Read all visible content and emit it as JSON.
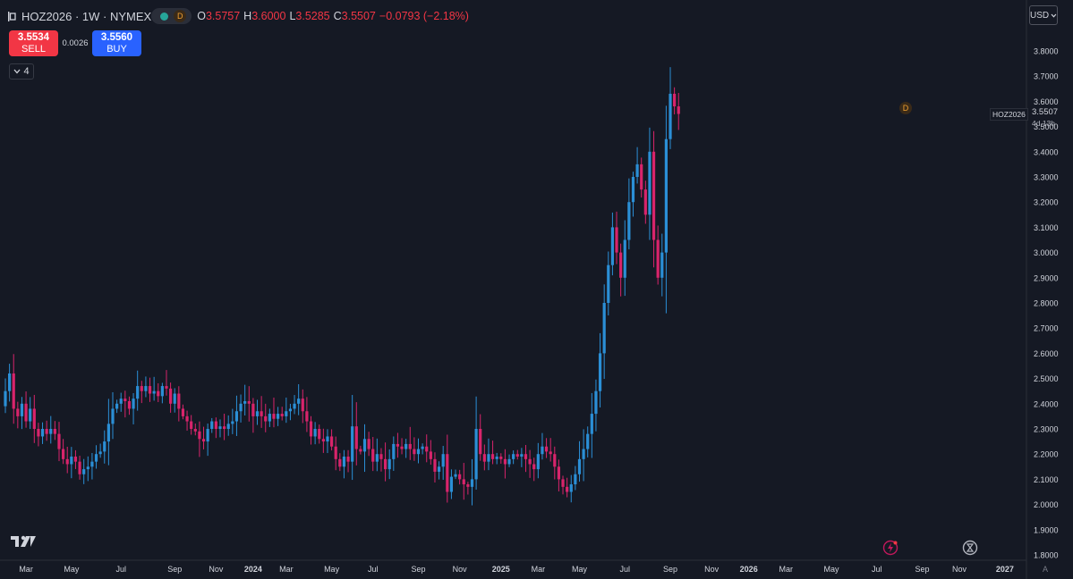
{
  "header": {
    "symbol": "HOZ2026 · 1W · NYMEX",
    "badge": "D",
    "ohlc": [
      {
        "k": "O",
        "v": "3.5757"
      },
      {
        "k": "H",
        "v": "3.6000"
      },
      {
        "k": "L",
        "v": "3.5285"
      },
      {
        "k": "C",
        "v": "3.5507"
      }
    ],
    "change": "−0.0793 (−2.18%)"
  },
  "trade": {
    "sell_price": "3.5534",
    "sell_label": "SELL",
    "spread": "0.0026",
    "buy_price": "3.5560",
    "buy_label": "BUY"
  },
  "indicators": {
    "count": "4"
  },
  "currency": "USD",
  "symbol_tag": "HOZ2026",
  "last_price": "3.5507",
  "countdown": "4d 13h",
  "marker_label": "D",
  "auto_label": "A",
  "colors": {
    "up": "#2b8fd6",
    "down": "#d8246b",
    "bg": "#151924",
    "grid": "#1e222d"
  },
  "chart_data": {
    "type": "candlestick",
    "title": "",
    "xlabel": "",
    "ylabel": "",
    "ylim": [
      1.8,
      3.8
    ],
    "y_ticks": [
      "3.8000",
      "3.7000",
      "3.6000",
      "3.5000",
      "3.4000",
      "3.3000",
      "3.2000",
      "3.1000",
      "3.0000",
      "2.9000",
      "2.8000",
      "2.7000",
      "2.6000",
      "2.5000",
      "2.4000",
      "2.3000",
      "2.2000",
      "2.1000",
      "2.0000",
      "1.9000",
      "1.8000"
    ],
    "x_ticks": [
      "Mar",
      "May",
      "Jul",
      "Sep",
      "Nov",
      "2024",
      "Mar",
      "May",
      "Jul",
      "Sep",
      "Nov",
      "2025",
      "Mar",
      "May",
      "Jul",
      "Sep",
      "Nov",
      "2026",
      "Mar",
      "May",
      "Jul",
      "Sep",
      "Nov",
      "2027"
    ],
    "x_tick_weeks": [
      5,
      16,
      28,
      41,
      51,
      60,
      68,
      79,
      89,
      100,
      110,
      120,
      129,
      139,
      150,
      161,
      171,
      180,
      189,
      200,
      211,
      222,
      231,
      242
    ],
    "series": [
      {
        "weekly_close": [
          2.45,
          2.52,
          2.38,
          2.35,
          2.4,
          2.33,
          2.38,
          2.3,
          2.27,
          2.3,
          2.28,
          2.3,
          2.28,
          2.22,
          2.18,
          2.16,
          2.19,
          2.17,
          2.12,
          2.14,
          2.15,
          2.17,
          2.2,
          2.21,
          2.25,
          2.32,
          2.38,
          2.4,
          2.42,
          2.41,
          2.38,
          2.42,
          2.47,
          2.45,
          2.47,
          2.44,
          2.45,
          2.43,
          2.47,
          2.46,
          2.4,
          2.44,
          2.38,
          2.35,
          2.33,
          2.3,
          2.29,
          2.26,
          2.25,
          2.3,
          2.33,
          2.3,
          2.31,
          2.3,
          2.32,
          2.33,
          2.37,
          2.4,
          2.41,
          2.4,
          2.35,
          2.37,
          2.35,
          2.33,
          2.36,
          2.34,
          2.36,
          2.35,
          2.37,
          2.38,
          2.4,
          2.42,
          2.37,
          2.33,
          2.27,
          2.3,
          2.26,
          2.25,
          2.27,
          2.23,
          2.18,
          2.15,
          2.19,
          2.17,
          2.31,
          2.22,
          2.21,
          2.26,
          2.22,
          2.17,
          2.2,
          2.18,
          2.14,
          2.18,
          2.24,
          2.23,
          2.22,
          2.24,
          2.22,
          2.2,
          2.22,
          2.23,
          2.21,
          2.18,
          2.13,
          2.15,
          2.2,
          2.05,
          2.11,
          2.12,
          2.1,
          2.08,
          2.07,
          2.1,
          2.3,
          2.2,
          2.17,
          2.2,
          2.18,
          2.19,
          2.18,
          2.16,
          2.18,
          2.2,
          2.19,
          2.2,
          2.18,
          2.16,
          2.14,
          2.2,
          2.23,
          2.21,
          2.2,
          2.15,
          2.1,
          2.07,
          2.05,
          2.08,
          2.12,
          2.18,
          2.22,
          2.28,
          2.36,
          2.45,
          2.6,
          2.8,
          2.95,
          3.1,
          3.0,
          2.9,
          3.05,
          3.2,
          3.3,
          3.35,
          3.25,
          3.15,
          3.4,
          3.05,
          2.9,
          3.0,
          3.45,
          3.63,
          3.58,
          3.55
        ],
        "note": "approximate weekly closes read from chart"
      }
    ]
  }
}
